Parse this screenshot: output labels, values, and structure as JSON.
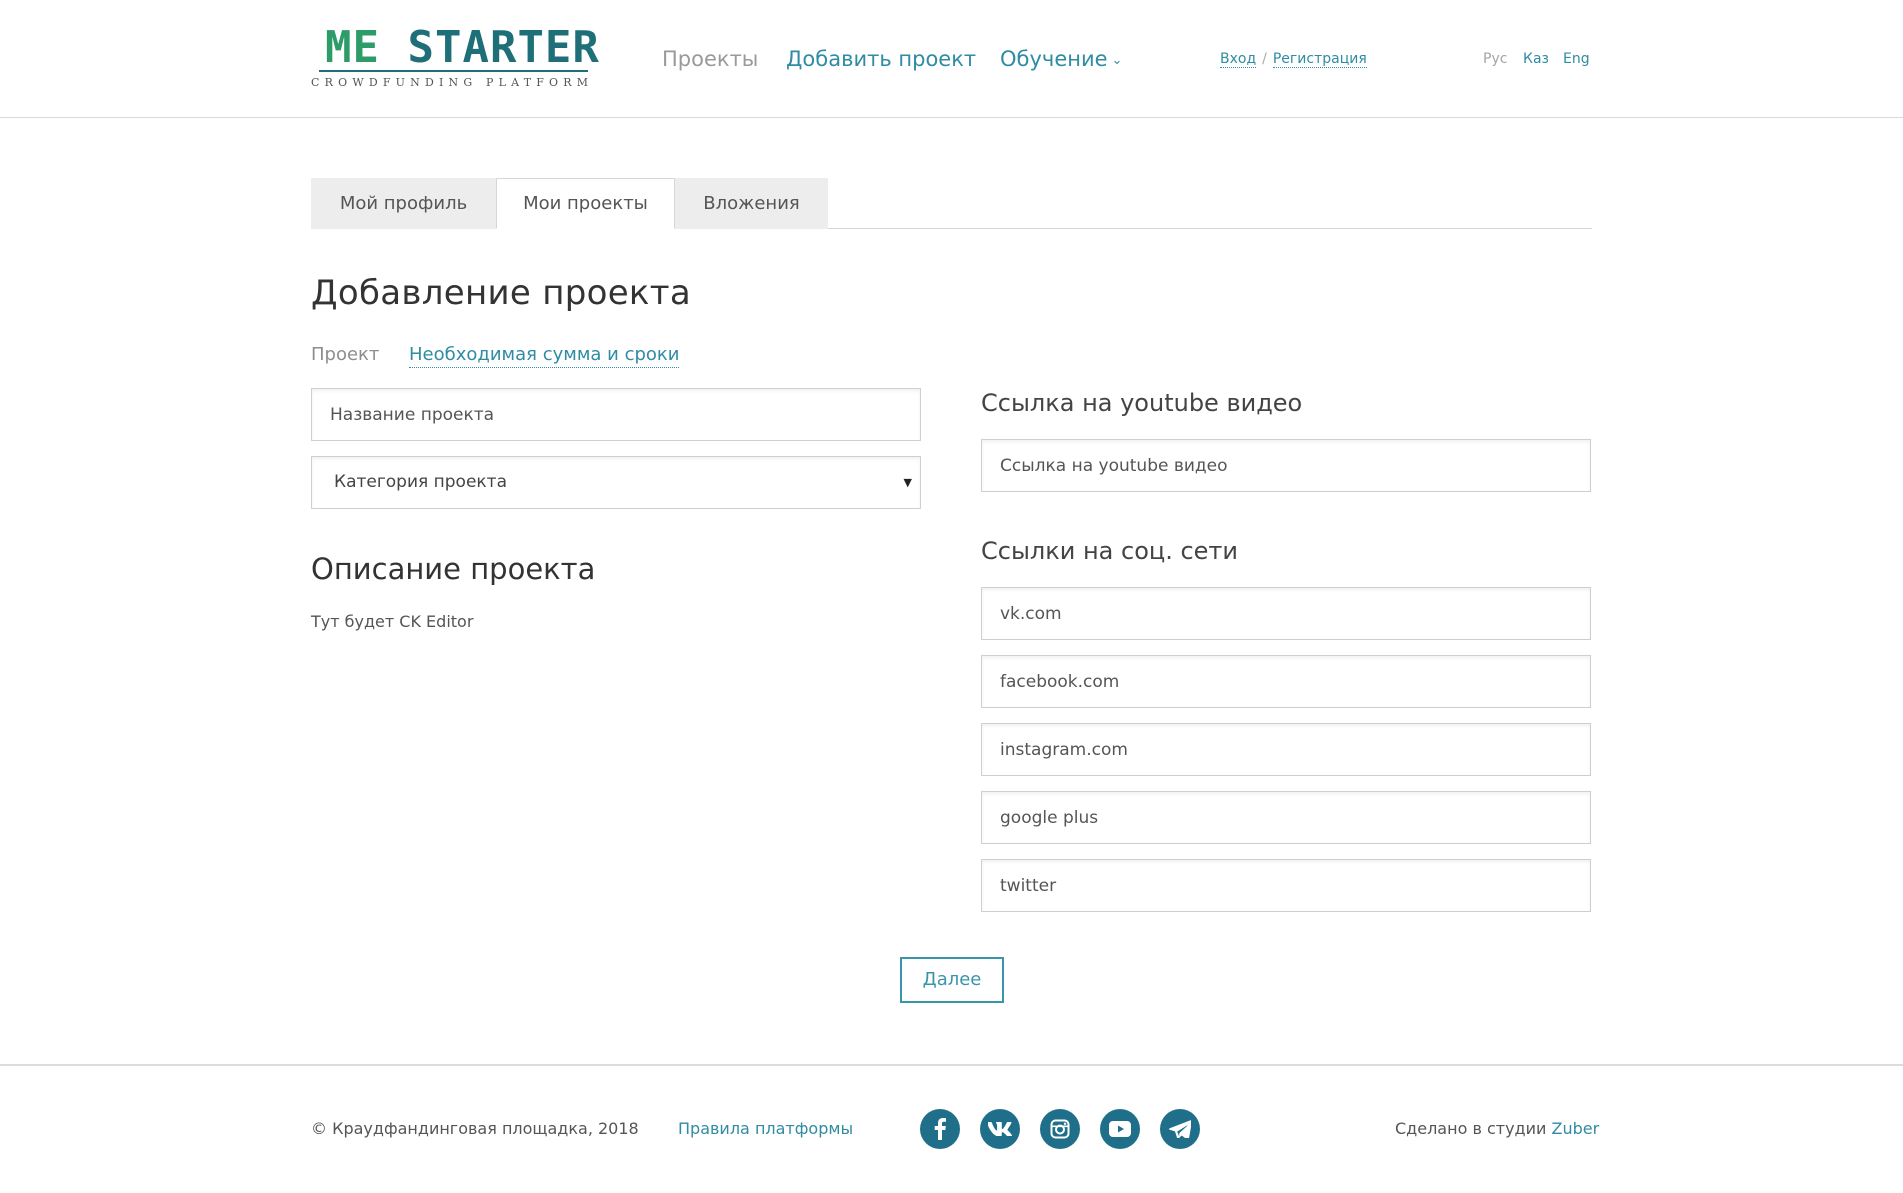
{
  "logo": {
    "title_part1": "ME",
    "title_part2": "STARTER",
    "subtitle": "CROWDFUNDING PLATFORM"
  },
  "nav": {
    "projects": "Проекты",
    "add_project": "Добавить проект",
    "learning": "Обучение"
  },
  "auth": {
    "login": "Вход",
    "separator": "/",
    "register": "Регистрация"
  },
  "languages": [
    "Рус",
    "Каз",
    "Eng"
  ],
  "tabs": [
    {
      "label": "Мой профиль",
      "active": false
    },
    {
      "label": "Мои проекты",
      "active": true
    },
    {
      "label": "Вложения",
      "active": false
    }
  ],
  "page": {
    "title": "Добавление проекта",
    "steps": {
      "step1": "Проект",
      "step2": "Необходимая сумма и сроки"
    }
  },
  "form": {
    "name_placeholder": "Название проекта",
    "category_value": "Категория проекта",
    "description_title": "Описание проекта",
    "description_text": "Тут будет CK Editor",
    "youtube_title": "Ссылка на youtube видео",
    "youtube_placeholder": "Ссылка на youtube видео",
    "social_title": "Ссылки на соц. сети",
    "social_placeholders": {
      "vk": "vk.com",
      "facebook": "facebook.com",
      "instagram": "instagram.com",
      "google_plus": "google plus",
      "twitter": "twitter"
    },
    "next_label": "Далее"
  },
  "footer": {
    "copyright": "© Краудфандинговая площадка, 2018",
    "rules": "Правила платформы",
    "made_by": "Сделано в студии",
    "studio": "Zuber",
    "social_icons": [
      "facebook-icon",
      "vk-icon",
      "instagram-icon",
      "youtube-icon",
      "telegram-icon"
    ]
  },
  "colors": {
    "accent": "#2f8ca3",
    "logo_green": "#2e9c68",
    "logo_teal": "#1f6f78",
    "social_bg": "#1f6f8a",
    "tab_bg": "#ededed"
  }
}
